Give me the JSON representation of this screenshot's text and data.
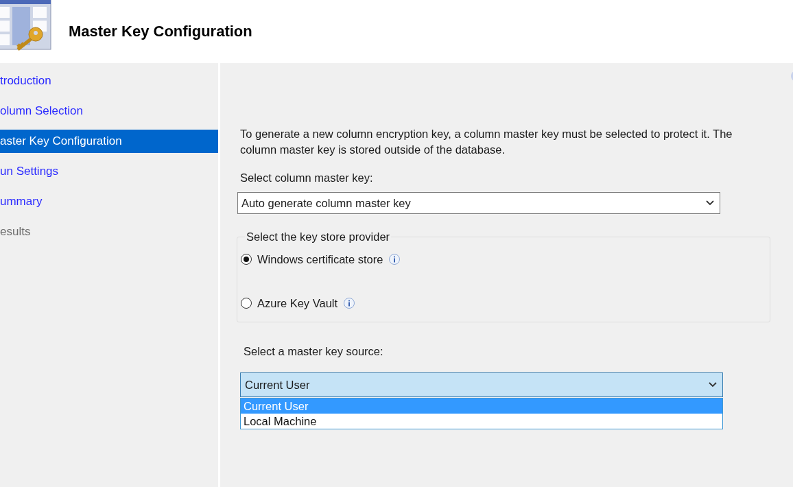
{
  "header": {
    "title": "Master Key Configuration"
  },
  "sidebar": {
    "items": [
      {
        "label": "troduction",
        "selected": false,
        "disabled": false
      },
      {
        "label": "olumn Selection",
        "selected": false,
        "disabled": false
      },
      {
        "label": "aster Key Configuration",
        "selected": true,
        "disabled": false
      },
      {
        "label": "un Settings",
        "selected": false,
        "disabled": false
      },
      {
        "label": "ummary",
        "selected": false,
        "disabled": false
      },
      {
        "label": "esults",
        "selected": false,
        "disabled": true
      }
    ]
  },
  "content": {
    "description": "To generate a new column encryption key, a column master key must be selected to protect it.  The column master key is stored outside of the database.",
    "master_key_label": "Select column master key:",
    "master_key_dropdown": {
      "value": "Auto generate column master key"
    },
    "provider_group": {
      "title": "Select the key store provider",
      "options": [
        {
          "label": "Windows certificate store",
          "selected": true
        },
        {
          "label": "Azure Key Vault",
          "selected": false
        }
      ]
    },
    "source_label": "Select a master key source:",
    "source_dropdown": {
      "value": "Current User",
      "expanded": true,
      "options": [
        {
          "label": "Current User",
          "selected": true
        },
        {
          "label": "Local Machine",
          "selected": false
        }
      ]
    }
  }
}
